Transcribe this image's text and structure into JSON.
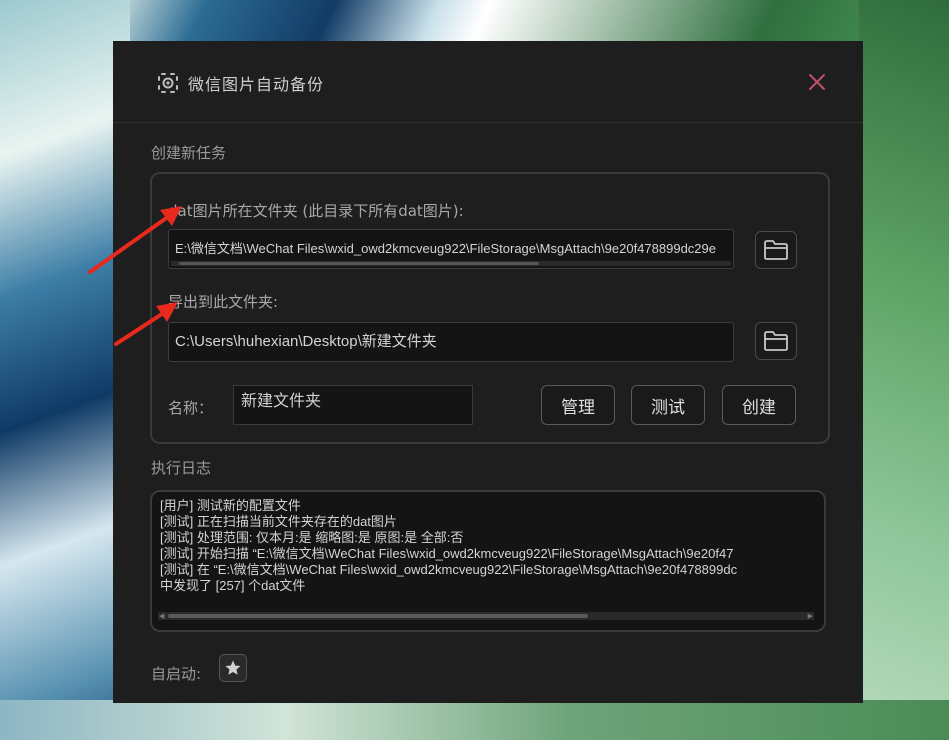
{
  "window": {
    "title": "微信图片自动备份",
    "icon": "wechat-camera-icon"
  },
  "task": {
    "section_title": "创建新任务",
    "source_label": "dat图片所在文件夹 (此目录下所有dat图片):",
    "source_value": "E:\\微信文档\\WeChat Files\\wxid_owd2kmcveug922\\FileStorage\\MsgAttach\\9e20f478899dc29e",
    "export_label": "导出到此文件夹:",
    "export_value": "C:\\Users\\huhexian\\Desktop\\新建文件夹",
    "name_label": "名称：",
    "name_value": "新建文件夹",
    "buttons": {
      "manage": "管理",
      "test": "测试",
      "create": "创建"
    }
  },
  "log": {
    "section_title": "执行日志",
    "lines": [
      "[用户] 测试新的配置文件",
      "[测试] 正在扫描当前文件夹存在的dat图片",
      "[测试] 处理范围: 仅本月:是   缩略图:是   原图:是   全部:否",
      "[测试] 开始扫描 “E:\\微信文档\\WeChat Files\\wxid_owd2kmcveug922\\FileStorage\\MsgAttach\\9e20f47",
      "[测试] 在 “E:\\微信文档\\WeChat Files\\wxid_owd2kmcveug922\\FileStorage\\MsgAttach\\9e20f478899dc",
      "中发现了 [257] 个dat文件"
    ]
  },
  "autostart": {
    "label": "自启动:",
    "icon": "star-icon"
  },
  "colors": {
    "window_bg": "#1e1e1f",
    "close_icon": "#c0506a",
    "annotation_arrow": "#e8291c"
  }
}
